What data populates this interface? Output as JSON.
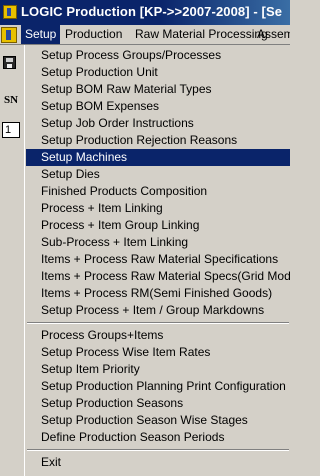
{
  "window": {
    "title": "LOGIC Production  [KP->>2007-2008] - [Se"
  },
  "menubar": {
    "items": [
      {
        "label": "Setup",
        "active": true
      },
      {
        "label": "Production",
        "active": false
      },
      {
        "label": "Raw Material Processing",
        "active": false
      },
      {
        "label": "Assemb",
        "active": false
      }
    ]
  },
  "background": {
    "grid_header": "SN",
    "grid_cell": "1"
  },
  "dropdown": {
    "highlighted": "Setup Machines",
    "group1": [
      "Setup Process Groups/Processes",
      "Setup Production Unit",
      "Setup BOM Raw Material Types",
      "Setup BOM Expenses",
      "Setup Job Order Instructions",
      "Setup Production Rejection Reasons",
      "Setup Machines",
      "Setup Dies",
      "Finished Products Composition",
      "Process + Item Linking",
      "Process + Item Group Linking",
      "Sub-Process + Item Linking",
      "Items + Process  Raw Material Specifications",
      "Items + Process Raw Material Specs(Grid Mode)",
      "Items + Process RM(Semi Finished Goods)",
      "Setup Process + Item / Group Markdowns"
    ],
    "group2": [
      "Process Groups+Items",
      "Setup Process Wise Item Rates",
      "Setup Item Priority",
      "Setup Production Planning Print Configuration",
      "Setup Production Seasons",
      "Setup Production Season Wise Stages",
      "Define Production Season Periods"
    ],
    "group3": [
      "Exit"
    ]
  }
}
